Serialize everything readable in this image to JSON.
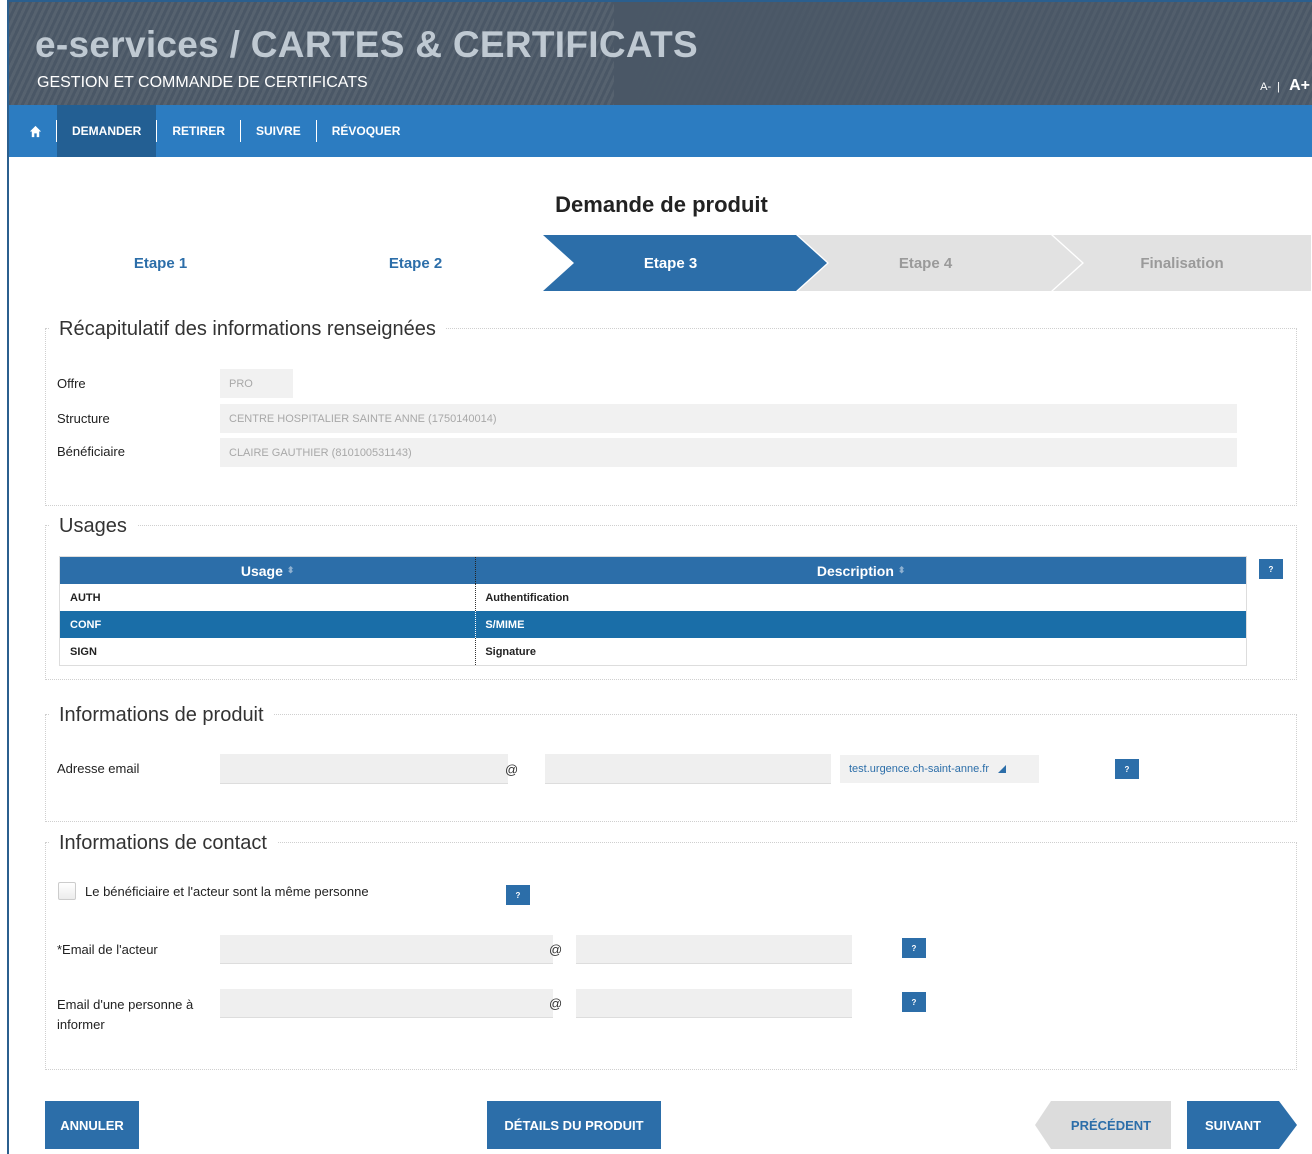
{
  "header": {
    "title": "e-services / CARTES & CERTIFICATS",
    "subtitle": "GESTION ET COMMANDE DE CERTIFICATS",
    "font_small": "A-",
    "font_sep": "|",
    "font_large": "A+"
  },
  "nav": {
    "home_icon": "home-icon",
    "items": [
      {
        "label": "DEMANDER"
      },
      {
        "label": "RETIRER"
      },
      {
        "label": "SUIVRE"
      },
      {
        "label": "RÉVOQUER"
      }
    ]
  },
  "page_title": "Demande de produit",
  "steps": [
    {
      "label": "Etape 1"
    },
    {
      "label": "Etape 2"
    },
    {
      "label": "Etape 3"
    },
    {
      "label": "Etape 4"
    },
    {
      "label": "Finalisation"
    }
  ],
  "recap": {
    "legend": "Récapitulatif des informations renseignées",
    "offre_label": "Offre",
    "offre_value": "PRO",
    "structure_label": "Structure",
    "structure_value": "CENTRE HOSPITALIER SAINTE ANNE (1750140014)",
    "beneficiaire_label": "Bénéficiaire",
    "beneficiaire_value": "CLAIRE GAUTHIER (810100531143)"
  },
  "usages": {
    "legend": "Usages",
    "col_usage": "Usage",
    "col_description": "Description",
    "sort_glyph": "⬍",
    "help": "?",
    "rows": [
      {
        "usage": "AUTH",
        "description": "Authentification"
      },
      {
        "usage": "CONF",
        "description": "S/MIME"
      },
      {
        "usage": "SIGN",
        "description": "Signature"
      }
    ]
  },
  "produit": {
    "legend": "Informations de produit",
    "email_label": "Adresse email",
    "at": "@",
    "domain_value": "test.urgence.ch-saint-anne.fr",
    "help": "?"
  },
  "contact": {
    "legend": "Informations de contact",
    "same_person_label": "Le bénéficiaire et l'acteur sont la même personne",
    "acteur_label": "*Email de l'acteur",
    "informer_label": "Email d'une personne à informer",
    "at": "@",
    "help": "?"
  },
  "buttons": {
    "annuler": "ANNULER",
    "details": "DÉTAILS DU PRODUIT",
    "precedent": "PRÉCÉDENT",
    "suivant": "SUIVANT"
  },
  "colors": {
    "primary": "#2c6ea9",
    "nav": "#2c7cc1",
    "selected_row": "#1a6ea8",
    "step_inactive": "#e2e2e2"
  }
}
